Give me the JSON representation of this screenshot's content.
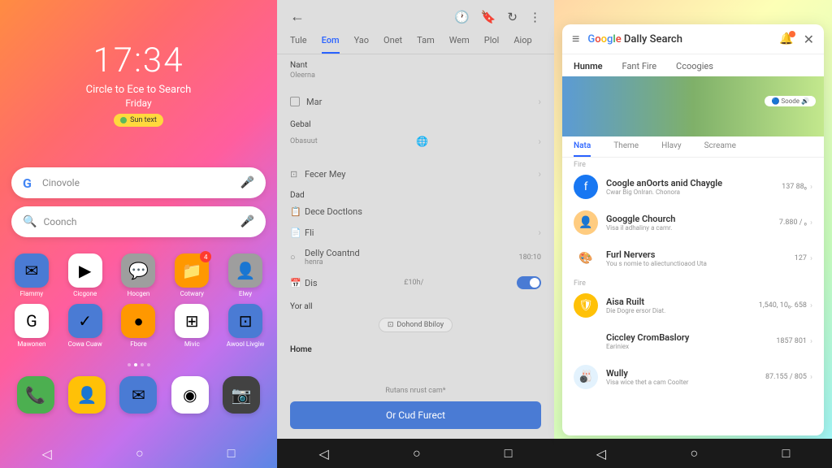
{
  "panel1": {
    "time": "17:34",
    "subtitle": "Circle to Ece to Search",
    "day": "Friday",
    "badge": "Sun text",
    "search1_placeholder": "Cinovole",
    "search2_placeholder": "Coonch",
    "apps_row1": [
      {
        "label": "Flammy",
        "bg": "#4a7bd4",
        "glyph": "✉"
      },
      {
        "label": "Cicgone",
        "bg": "#ffffff",
        "glyph": "▶"
      },
      {
        "label": "Hocgen",
        "bg": "#9e9e9e",
        "glyph": "💬"
      },
      {
        "label": "Cotwary",
        "bg": "#ff9800",
        "glyph": "📁",
        "badge": "4"
      },
      {
        "label": "Elwy",
        "bg": "#9e9e9e",
        "glyph": "👤"
      }
    ],
    "apps_row2": [
      {
        "label": "Mawonen",
        "bg": "#ffffff",
        "glyph": "G"
      },
      {
        "label": "Cowa Cuaw",
        "bg": "#4a7bd4",
        "glyph": "✓"
      },
      {
        "label": "Fbore",
        "bg": "#ff9800",
        "glyph": "●"
      },
      {
        "label": "Mivic",
        "bg": "#ffffff",
        "glyph": "⊞"
      },
      {
        "label": "Awool Livgiw",
        "bg": "#4a7bd4",
        "glyph": "⊡"
      }
    ],
    "dock": [
      {
        "bg": "#4caf50",
        "glyph": "📞"
      },
      {
        "bg": "#ffc107",
        "glyph": "👤"
      },
      {
        "bg": "#4a7bd4",
        "glyph": "✉"
      },
      {
        "bg": "#ffffff",
        "glyph": "◉"
      },
      {
        "bg": "#424242",
        "glyph": "📷"
      }
    ]
  },
  "panel2": {
    "tabs": [
      "Tule",
      "Eom",
      "Yao",
      "Onet",
      "Tam",
      "Wem",
      "Plol",
      "Aiop"
    ],
    "active_tab": 1,
    "name_label": "Nant",
    "name_value": "Oleerna",
    "checkbox_label": "Mar",
    "detail_label": "Gebal",
    "detail_value": "Obasuut",
    "option1": "Fecer Mey",
    "section_label": "Dad",
    "option2": "Dece Doctlons",
    "option3": "Fli",
    "control_label": "Delly Coantnd",
    "control_sub": "henra",
    "control_value": "180:10",
    "toggle_label": "Dis",
    "toggle_value": "£10h/",
    "your_label": "Yor  all",
    "chip": "Dohond Bbiloy",
    "home_label": "Home",
    "hint": "Rutans nrust cam*",
    "button": "Or Cud Furect"
  },
  "panel3": {
    "title_prefix": "Google",
    "title_suffix": " Dally Search",
    "nav": [
      "Hunme",
      "Fant Fire",
      "Ccoogies"
    ],
    "hero_pill": "🔵 Soode 🔊",
    "subtabs": [
      "Nata",
      "Theme",
      "Hlavy",
      "Screame"
    ],
    "section1": "Fire",
    "section2": "Fire",
    "items": [
      {
        "title": "Coogle anOorts anid Chaygle",
        "sub": "Cwar Big Onlran. Chonora",
        "meta": "137  88₀",
        "bg": "#1877f2",
        "glyph": "f"
      },
      {
        "title": "Googgle Chourch",
        "sub": "Visa il adhaliny a camr.",
        "meta": "7.880 / ₀",
        "bg": "#ffcc80",
        "glyph": "👤"
      },
      {
        "title": "Furl Nervers",
        "sub": "You  s nomie to aliectunctioaod Uta",
        "meta": "127",
        "bg": "#ffffff",
        "glyph": "🎨"
      },
      {
        "title": "Aisa Ruilt",
        "sub": "Die Dogre ersor Diat.",
        "meta": "1,540, 10₀. 658",
        "bg": "#ffc107",
        "glyph": "🛡"
      },
      {
        "title": "Ciccley CromBaslory",
        "sub": "Eariniex",
        "meta": "1857 801",
        "bg": "#ffffff",
        "glyph": "◉"
      },
      {
        "title": "Wully",
        "sub": "Visa wice thet a cam Coolter",
        "meta": "87.155 / 805",
        "bg": "#e3f2fd",
        "glyph": "🎳"
      }
    ]
  }
}
